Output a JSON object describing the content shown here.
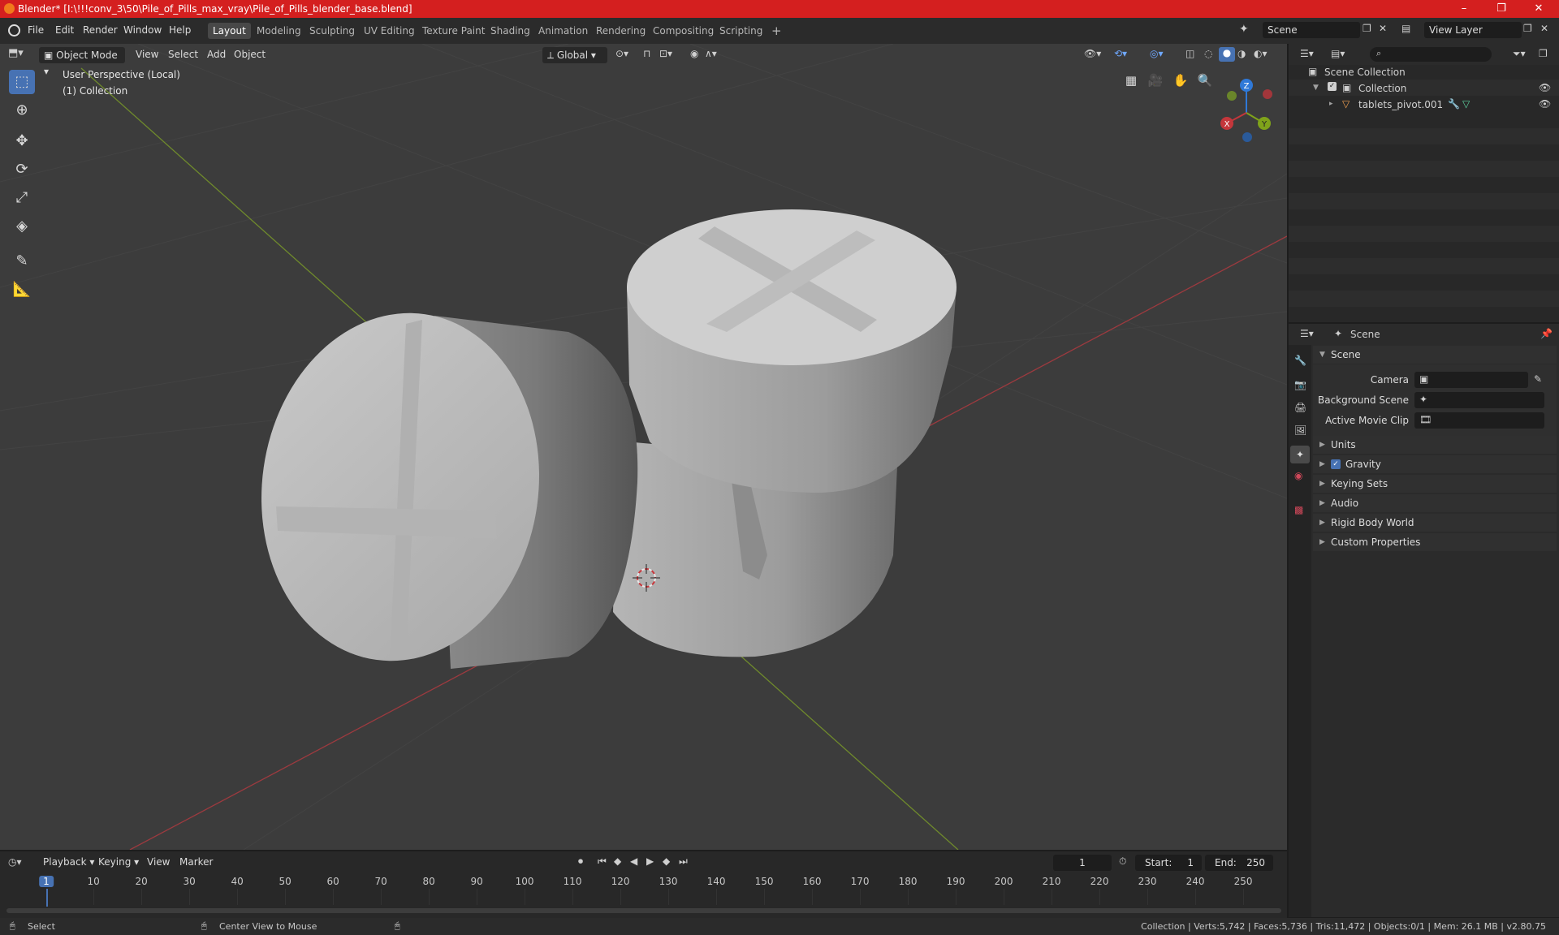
{
  "window": {
    "title": "Blender* [I:\\!!!conv_3\\50\\Pile_of_Pills_max_vray\\Pile_of_Pills_blender_base.blend]",
    "min": "–",
    "max": "❐",
    "close": "✕"
  },
  "menu": [
    "File",
    "Edit",
    "Render",
    "Window",
    "Help"
  ],
  "workspaces": [
    "Layout",
    "Modeling",
    "Sculpting",
    "UV Editing",
    "Texture Paint",
    "Shading",
    "Animation",
    "Rendering",
    "Compositing",
    "Scripting"
  ],
  "active_workspace": "Layout",
  "add_workspace": "+",
  "scene_field": "Scene",
  "view_layer_field": "View Layer",
  "viewport": {
    "mode": "Object Mode",
    "menus": [
      "View",
      "Select",
      "Add",
      "Object"
    ],
    "orientation": "Global",
    "overlay_line1": "User Perspective (Local)",
    "overlay_line2": "(1) Collection",
    "gizmo": {
      "x": "X",
      "y": "Y",
      "z": "Z"
    }
  },
  "outliner": {
    "root": "Scene Collection",
    "collection": "Collection",
    "object": "tablets_pivot.001"
  },
  "properties": {
    "header": "Scene",
    "panel": "Scene",
    "fields": [
      "Camera",
      "Background Scene",
      "Active Movie Clip"
    ],
    "sections": [
      "Units",
      "Gravity",
      "Keying Sets",
      "Audio",
      "Rigid Body World",
      "Custom Properties"
    ],
    "gravity_checked": true
  },
  "timeline": {
    "menus": [
      "Playback",
      "Keying",
      "View",
      "Marker"
    ],
    "current_frame": "1",
    "start_label": "Start:",
    "start_value": "1",
    "end_label": "End:",
    "end_value": "250",
    "ticks": [
      "1",
      "10",
      "20",
      "30",
      "40",
      "50",
      "60",
      "70",
      "80",
      "90",
      "100",
      "110",
      "120",
      "130",
      "140",
      "150",
      "160",
      "170",
      "180",
      "190",
      "200",
      "210",
      "220",
      "230",
      "240",
      "250"
    ]
  },
  "statusbar": {
    "left1": "Select",
    "left2": "Center View to Mouse",
    "right": "Collection | Verts:5,742 | Faces:5,736 | Tris:11,472 | Objects:0/1 | Mem: 26.1 MB | v2.80.75"
  },
  "colors": {
    "titlebar": "#d41f1f",
    "accent": "#4772b3",
    "x_axis": "#c4363b",
    "y_axis": "#7fa31a",
    "z_axis": "#2f79d8"
  }
}
